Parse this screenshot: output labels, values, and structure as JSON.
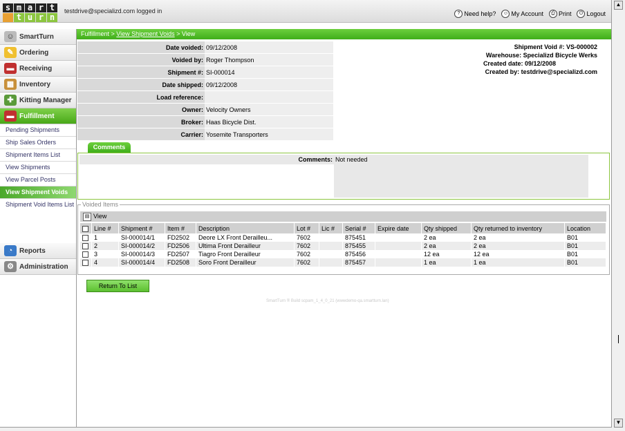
{
  "logo": {
    "row1": [
      "s",
      "m",
      "a",
      "r",
      "t"
    ],
    "row2": [
      "t",
      "u",
      "r",
      "n"
    ]
  },
  "header": {
    "logged_in": "testdrive@specializd.com logged in",
    "links": [
      {
        "label": "Need help?",
        "icon": "help-icon"
      },
      {
        "label": "My Account",
        "icon": "account-icon"
      },
      {
        "label": "Print",
        "icon": "print-icon"
      },
      {
        "label": "Logout",
        "icon": "logout-icon"
      }
    ]
  },
  "sidebar": {
    "top_items": [
      {
        "label": "SmartTurn",
        "icon": "people-icon"
      },
      {
        "label": "Ordering",
        "icon": "ordering-icon"
      },
      {
        "label": "Receiving",
        "icon": "truck-icon"
      },
      {
        "label": "Inventory",
        "icon": "boxes-icon"
      },
      {
        "label": "Kitting Manager",
        "icon": "kitting-icon"
      },
      {
        "label": "Fulfillment",
        "icon": "fulfillment-truck-icon"
      }
    ],
    "sub_items": [
      "Pending Shipments",
      "Ship Sales Orders",
      "Shipment Items List",
      "View Shipments",
      "View Parcel Posts",
      "View Shipment Voids",
      "Shipment Void Items List"
    ],
    "bottom_items": [
      {
        "label": "Reports",
        "icon": "reports-icon"
      },
      {
        "label": "Administration",
        "icon": "gear-icon"
      }
    ]
  },
  "breadcrumb": {
    "part1": "Fulfillment > ",
    "link": "View Shipment Voids",
    "part2": " > View"
  },
  "details": [
    {
      "label": "Date voided:",
      "value": "09/12/2008"
    },
    {
      "label": "Voided by:",
      "value": "Roger Thompson"
    },
    {
      "label": "Shipment #:",
      "value": "SI-000014"
    },
    {
      "label": "Date shipped:",
      "value": "09/12/2008"
    },
    {
      "label": "Load reference:",
      "value": ""
    },
    {
      "label": "Owner:",
      "value": "Velocity Owners"
    },
    {
      "label": "Broker:",
      "value": "Haas Bicycle Dist."
    },
    {
      "label": "Carrier:",
      "value": "Yosemite Transporters"
    }
  ],
  "summary": {
    "line1": "Shipment Void #: VS-000002",
    "line2": "Warehouse: Specializd Bicycle Werks",
    "line3": "Created date: 09/12/2008",
    "line4": "Created by: testdrive@specializd.com"
  },
  "comments": {
    "tab": "Comments",
    "label": "Comments:",
    "value": "Not needed"
  },
  "voided_items": {
    "legend": "Voided Items",
    "view_label": "View",
    "columns": [
      "Line #",
      "Shipment #",
      "Item #",
      "Description",
      "Lot #",
      "Lic #",
      "Serial #",
      "Expire date",
      "Qty shipped",
      "Qty returned to inventory",
      "Location"
    ],
    "rows": [
      [
        "1",
        "SI-000014/1",
        "FD2502",
        "Deore LX Front Derailleu...",
        "7602",
        "",
        "875451",
        "",
        "2 ea",
        "2 ea",
        "B01"
      ],
      [
        "2",
        "SI-000014/2",
        "FD2506",
        "Ultima Front Derailleur",
        "7602",
        "",
        "875455",
        "",
        "2 ea",
        "2 ea",
        "B01"
      ],
      [
        "3",
        "SI-000014/3",
        "FD2507",
        "Tiagro Front Derailleur",
        "7602",
        "",
        "875456",
        "",
        "12 ea",
        "12 ea",
        "B01"
      ],
      [
        "4",
        "SI-000014/4",
        "FD2508",
        "Soro Front Derailleur",
        "7602",
        "",
        "875457",
        "",
        "1 ea",
        "1 ea",
        "B01"
      ]
    ]
  },
  "return_button": "Return To List",
  "build_text": "SmartTurn ® Build scpam_1_4_0_21 (wwwdemo-qa.smartturn.lan)"
}
